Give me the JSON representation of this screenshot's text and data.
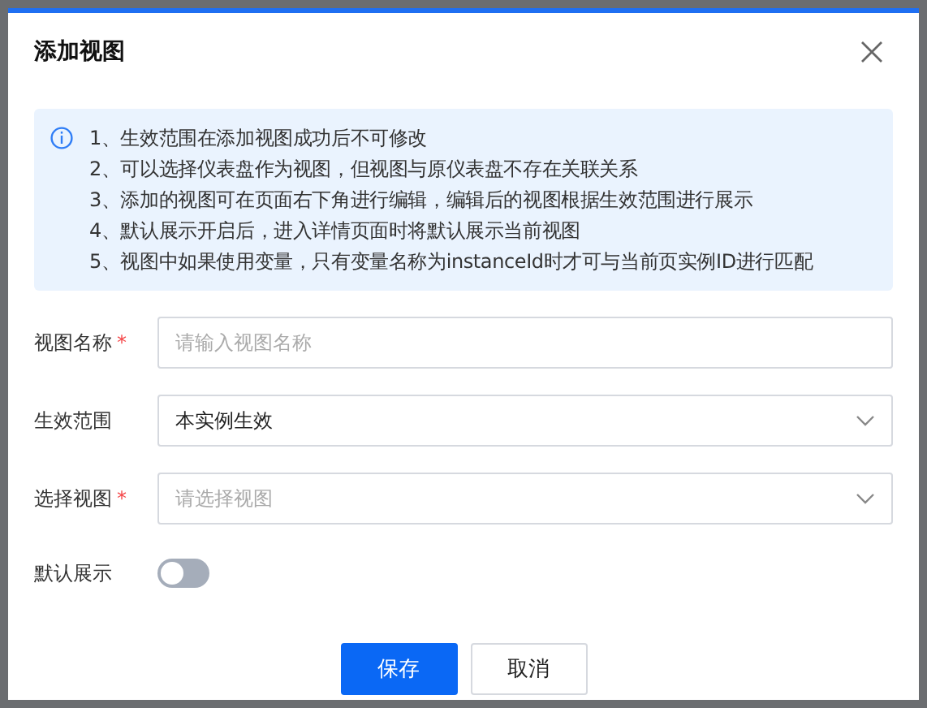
{
  "dialog": {
    "title": "添加视图",
    "notice": [
      "1、生效范围在添加视图成功后不可修改",
      "2、可以选择仪表盘作为视图，但视图与原仪表盘不存在关联关系",
      "3、添加的视图可在页面右下角进行编辑，编辑后的视图根据生效范围进行展示",
      "4、默认展示开启后，进入详情页面时将默认展示当前视图",
      "5、视图中如果使用变量，只有变量名称为instanceId时才可与当前页实例ID进行匹配"
    ],
    "fields": [
      {
        "kind": "input",
        "label": "视图名称",
        "required_mark": "*",
        "placeholder": "请输入视图名称"
      },
      {
        "kind": "select",
        "label": "生效范围",
        "value": "本实例生效"
      },
      {
        "kind": "select",
        "label": "选择视图",
        "required_mark": "*",
        "placeholder": "请选择视图"
      },
      {
        "kind": "switch",
        "label": "默认展示",
        "on": false
      }
    ],
    "buttons": [
      {
        "label": "保存",
        "primary": true
      },
      {
        "label": "取消",
        "primary": false
      }
    ]
  }
}
